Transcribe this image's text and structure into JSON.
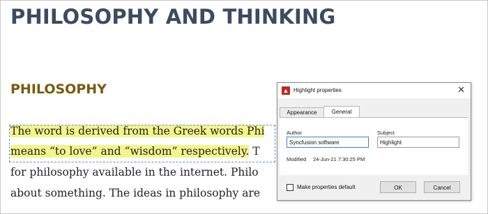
{
  "document": {
    "title": "PHILOSOPHY AND THINKING",
    "section_heading": "PHILOSOPHY",
    "lines": [
      {
        "highlighted": "The word is derived from the Greek words Phi",
        "rest": ""
      },
      {
        "highlighted": "means “to love” and “wisdom” respectively.",
        "rest": " T"
      },
      {
        "highlighted": "",
        "rest": "for philosophy available in the internet. Philo"
      },
      {
        "highlighted": "",
        "rest": "about something. The ideas in philosophy are"
      }
    ]
  },
  "dialog": {
    "title": "Highlight properties",
    "close_glyph": "✕",
    "app_icon_glyph": "▲",
    "tabs": [
      {
        "label": "Appearance",
        "selected": false
      },
      {
        "label": "General",
        "selected": true
      }
    ],
    "author_label": "Author",
    "author_value": "Syncfusion software",
    "subject_label": "Subject",
    "subject_value": "Highlight",
    "modified_label": "Modified",
    "modified_value": "24-Jun-21 7:30:25 PM",
    "checkbox_label": "Make properties default",
    "checkbox_checked": false,
    "ok_label": "OK",
    "cancel_label": "Cancel"
  },
  "colors": {
    "title": "#3d4b5e",
    "heading": "#7a5a10",
    "highlight": "#f3f58a",
    "app_icon": "#c0281d"
  }
}
